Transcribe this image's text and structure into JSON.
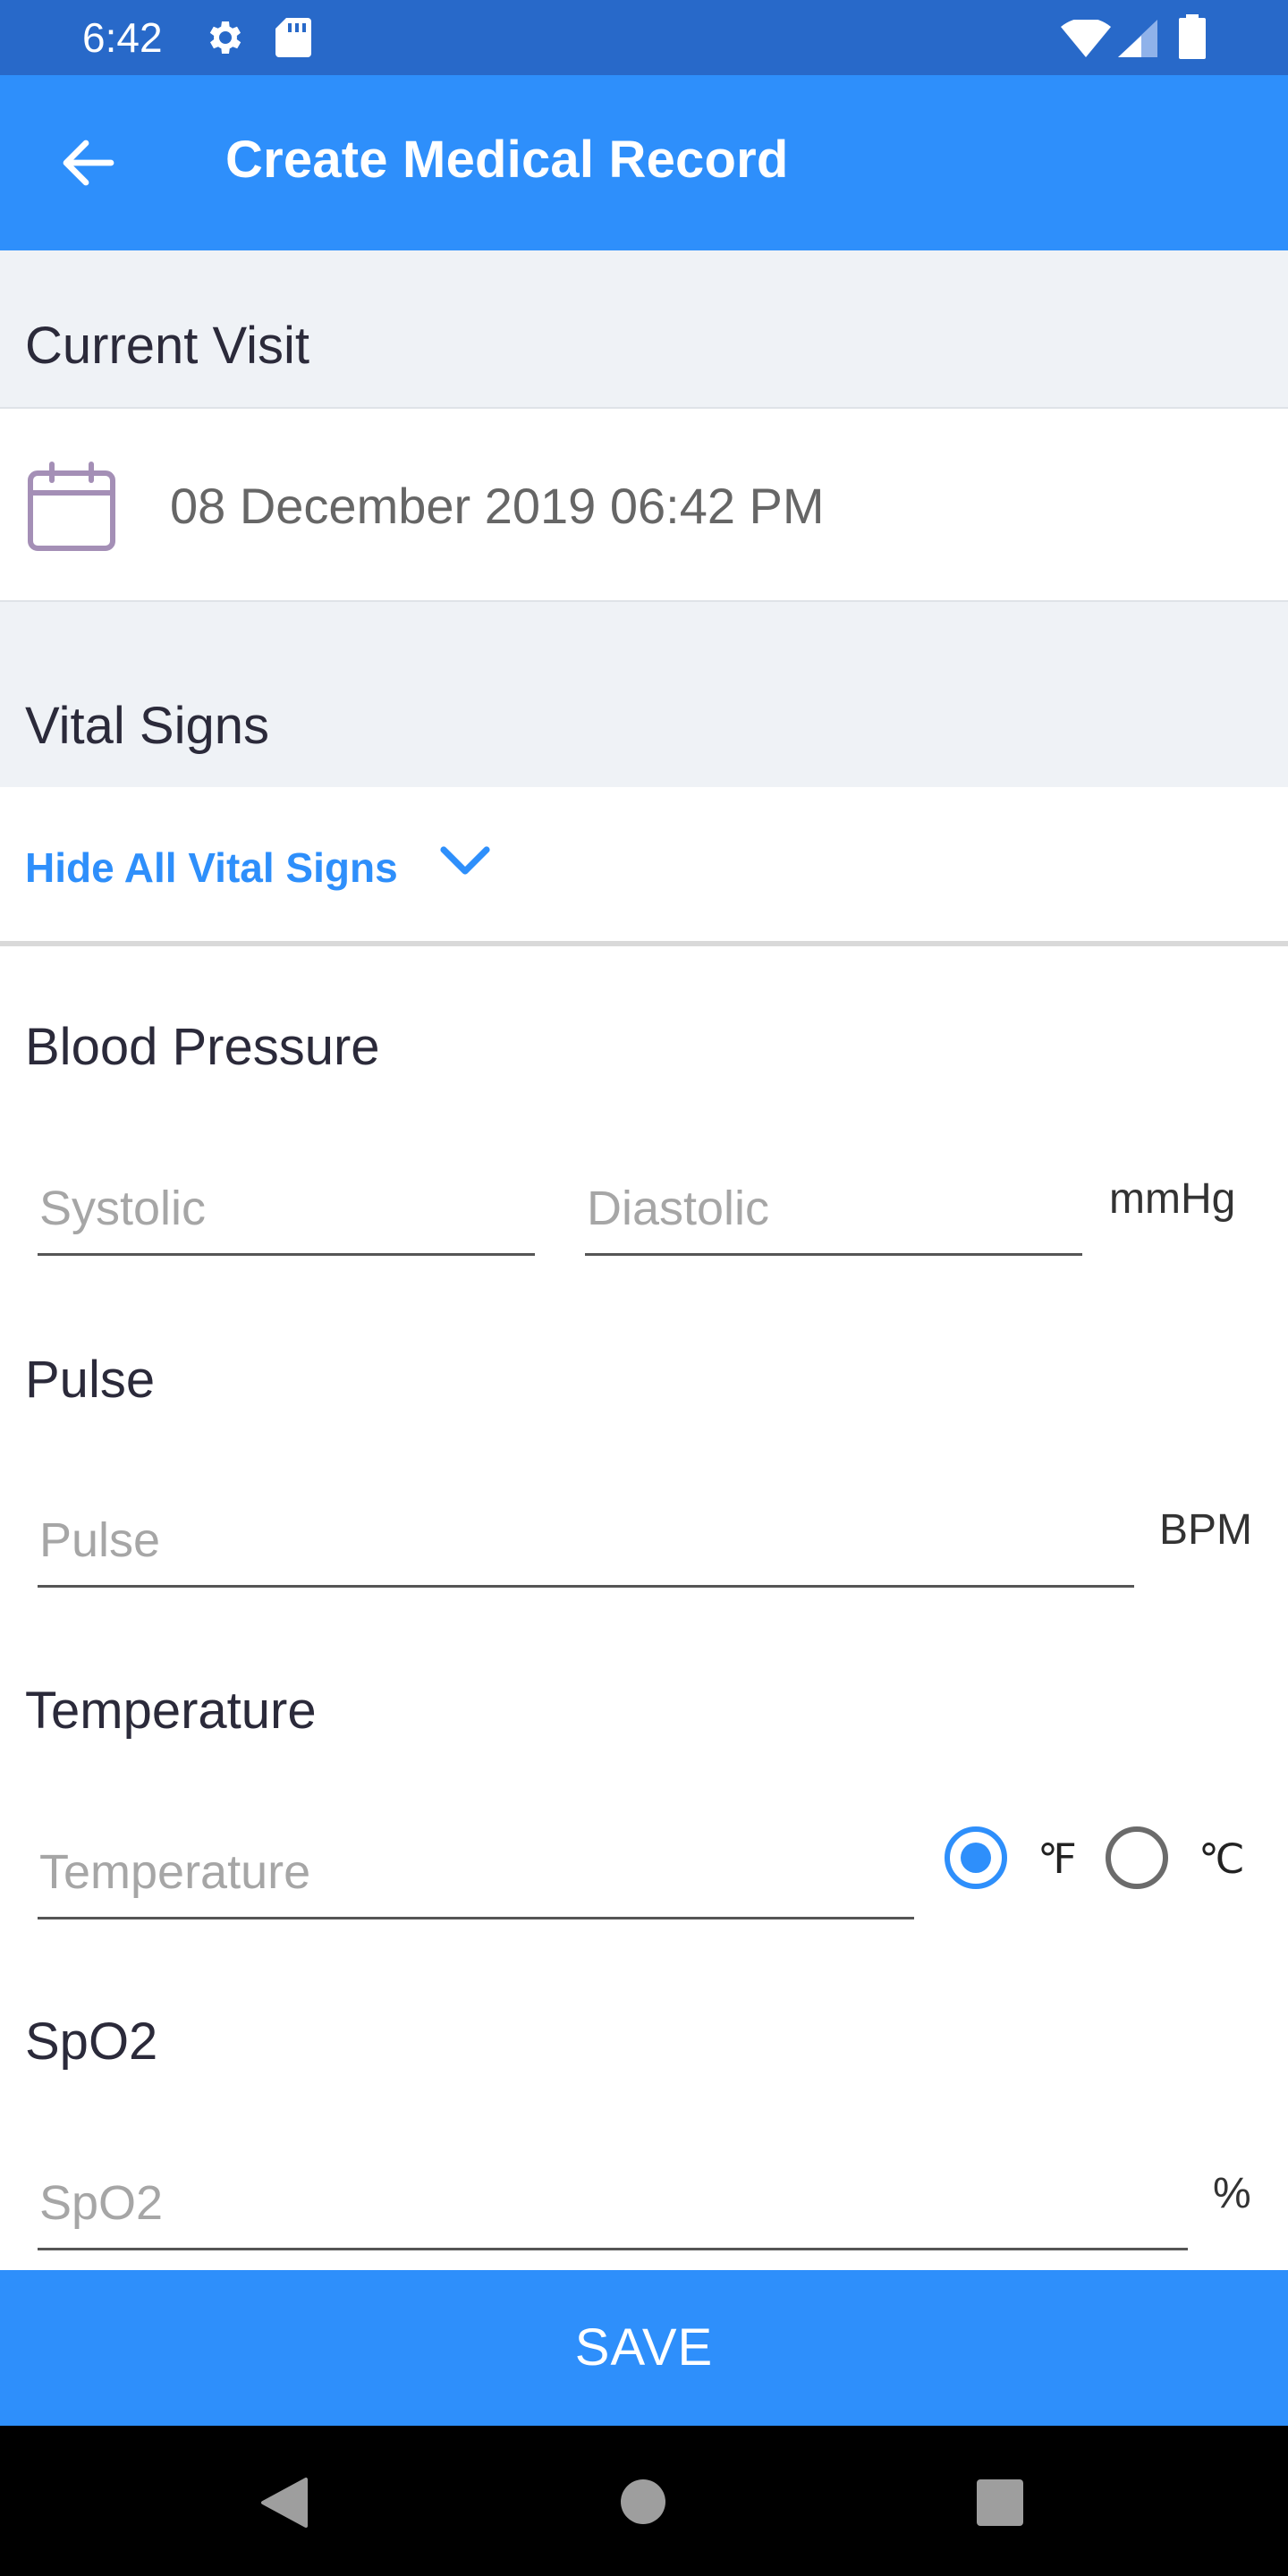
{
  "status_bar": {
    "time": "6:42"
  },
  "app_bar": {
    "title": "Create Medical Record"
  },
  "current_visit": {
    "header": "Current Visit",
    "date": "08 December 2019 06:42 PM"
  },
  "vital_signs": {
    "header": "Vital Signs",
    "toggle_label": "Hide All Vital Signs"
  },
  "blood_pressure": {
    "title": "Blood Pressure",
    "systolic_placeholder": "Systolic",
    "diastolic_placeholder": "Diastolic",
    "unit": "mmHg"
  },
  "pulse": {
    "title": "Pulse",
    "placeholder": "Pulse",
    "unit": "BPM"
  },
  "temperature": {
    "title": "Temperature",
    "placeholder": "Temperature",
    "unit_f": "℉",
    "unit_c": "℃",
    "selected": "F"
  },
  "spo2": {
    "title": "SpO2",
    "placeholder": "SpO2",
    "unit": "%"
  },
  "save_label": "SAVE",
  "colors": {
    "primary": "#2e8ffb",
    "status_bar": "#2869c9",
    "section_bg": "#eff2f6"
  }
}
